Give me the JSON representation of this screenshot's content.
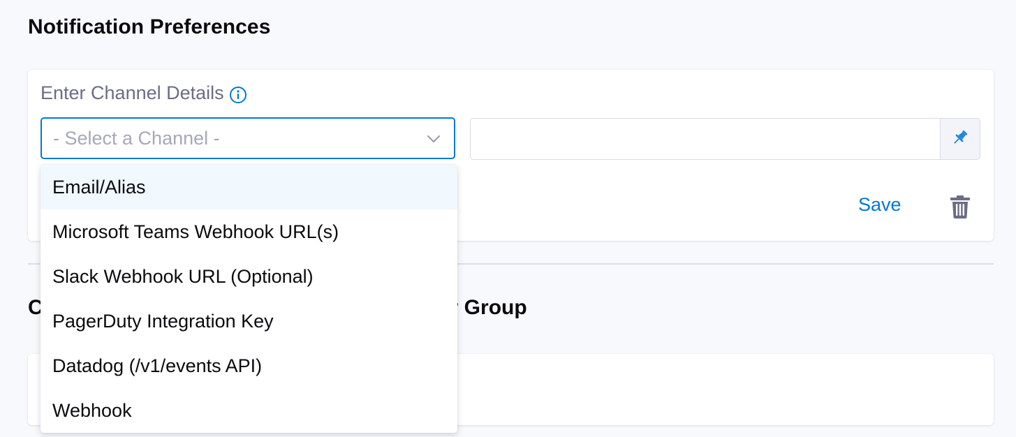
{
  "header": {
    "title": "Notification Preferences"
  },
  "channel_card": {
    "label": "Enter Channel Details",
    "select_placeholder": "- Select a Channel -",
    "input_value": "",
    "save_label": "Save"
  },
  "dropdown": {
    "options": [
      "Email/Alias",
      "Microsoft Teams Webhook URL(s)",
      "Slack Webhook URL (Optional)",
      "PagerDuty Integration Key",
      "Datadog (/v1/events API)",
      "Webhook"
    ],
    "highlighted_index": 0
  },
  "second_section": {
    "title_visible_start": "C",
    "title_visible_end": "r Group"
  },
  "colors": {
    "accent": "#0278d5",
    "highlight": "#f1f8fe",
    "muted_text": "#6b6d85",
    "placeholder_text": "#a6a8b9"
  },
  "icons": {
    "info": "info-icon",
    "chevron": "chevron-down-icon",
    "pin": "pin-icon",
    "trash": "trash-icon"
  }
}
